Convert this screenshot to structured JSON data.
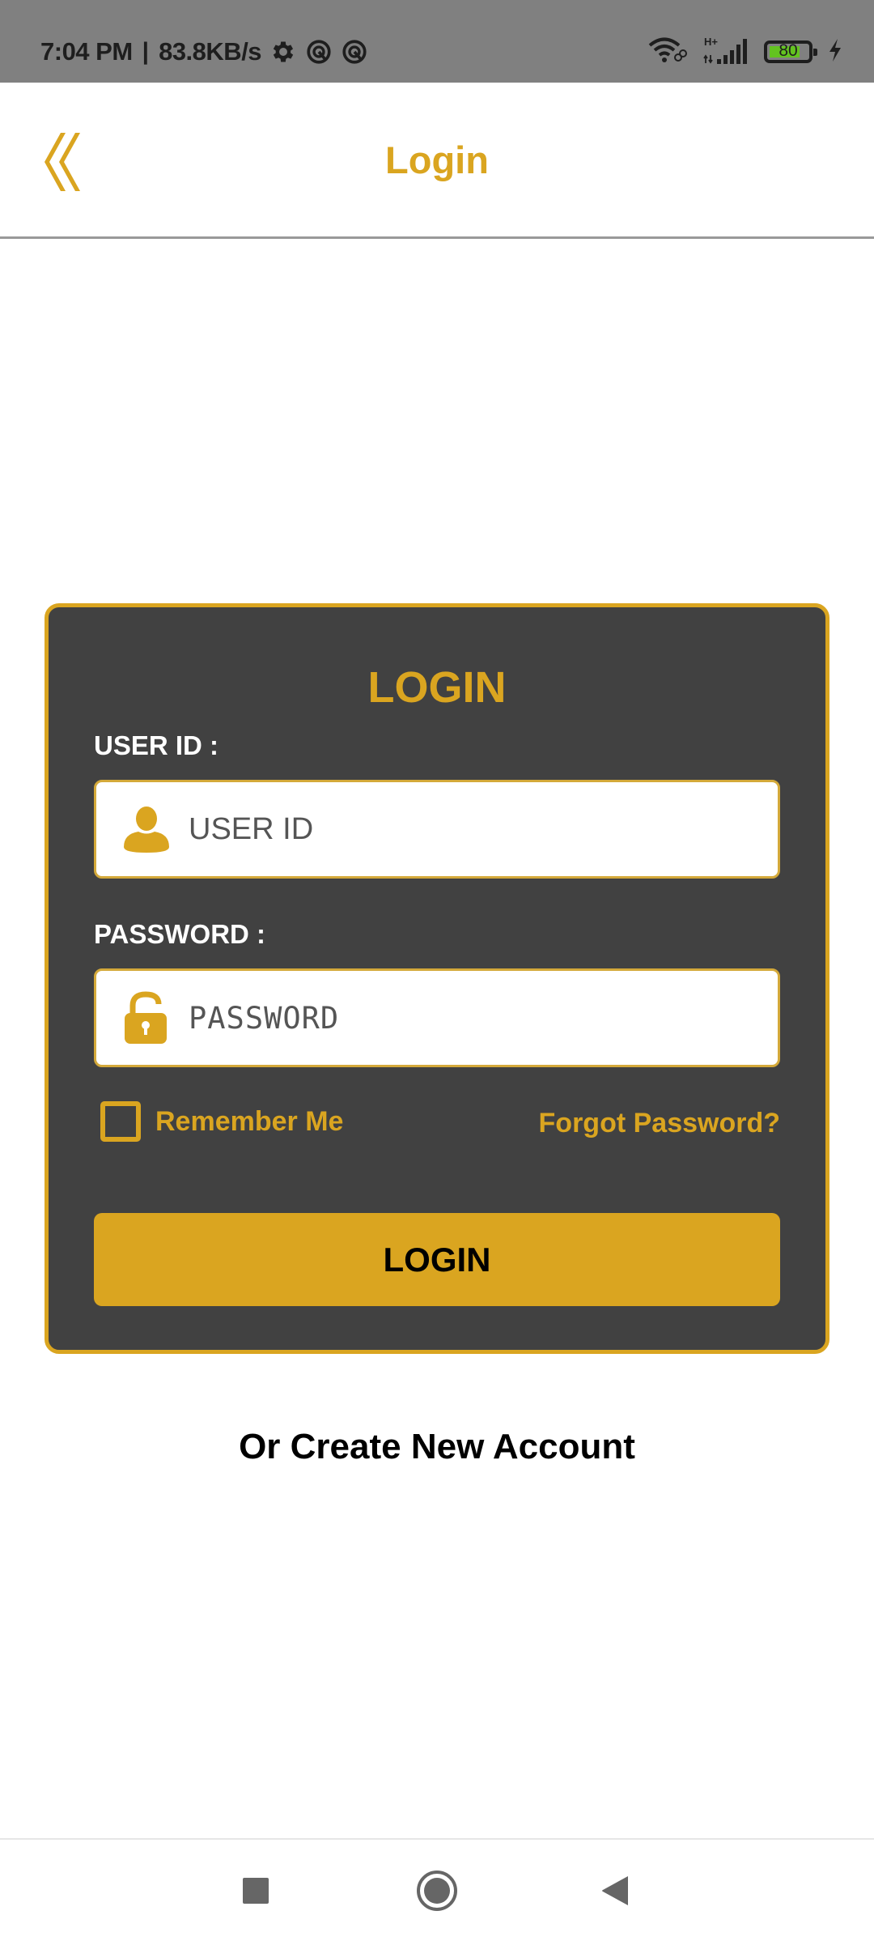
{
  "status_bar": {
    "time": "7:04 PM",
    "separator": "|",
    "network_speed": "83.8KB/s",
    "left_icons": [
      "gear-icon",
      "notification-app-icon",
      "notification-app-icon"
    ],
    "network_type": "H+",
    "battery_level": "80",
    "battery_fraction": 0.8,
    "charging": true,
    "battery_color": "#63c320"
  },
  "header": {
    "title": "Login",
    "back_icon": "double-chevron-left-icon"
  },
  "theme": {
    "accent": "#DAA520",
    "card_background": "#414141",
    "status_bar_background": "#808080"
  },
  "login_card": {
    "title": "LOGIN",
    "user_id": {
      "label": "USER ID :",
      "placeholder": "USER ID",
      "value": "",
      "icon": "user-icon"
    },
    "password": {
      "label": "PASSWORD :",
      "placeholder": "PASSWORD",
      "value": "",
      "icon": "unlock-icon"
    },
    "remember_me": {
      "label": "Remember Me",
      "checked": false
    },
    "forgot_password": "Forgot Password?",
    "login_button": "LOGIN"
  },
  "create_account": "Or Create New Account",
  "nav_bar": {
    "buttons": [
      "recents",
      "home",
      "back"
    ]
  }
}
